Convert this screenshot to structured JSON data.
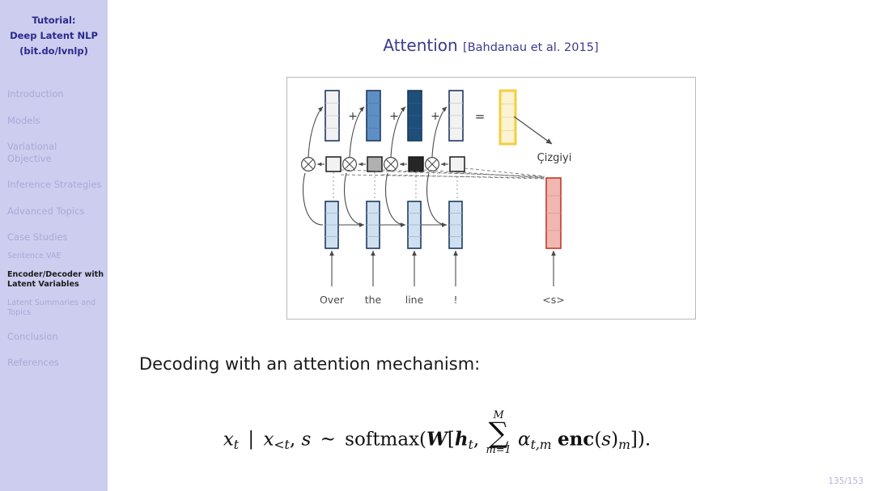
{
  "sidebar": {
    "title_lines": [
      "Tutorial:",
      "Deep Latent NLP",
      "(bit.do/lvnlp)"
    ],
    "sections": [
      {
        "label": "Introduction",
        "active": false
      },
      {
        "label": "Models",
        "active": false
      },
      {
        "label": "Variational Objective",
        "active": false
      },
      {
        "label": "Inference Strategies",
        "active": false
      },
      {
        "label": "Advanced Topics",
        "active": false
      },
      {
        "label": "Case Studies",
        "active": false
      }
    ],
    "subsections": [
      {
        "label": "Sentence VAE",
        "active": false
      },
      {
        "label": "Encoder/Decoder with Latent Variables",
        "active": true
      },
      {
        "label": "Latent Summaries and Topics",
        "active": false
      }
    ],
    "sections_tail": [
      {
        "label": "Conclusion",
        "active": false
      },
      {
        "label": "References",
        "active": false
      }
    ],
    "accent_color": "#2a2a8c",
    "background_color": "#cdcdf0",
    "inactive_color": "#a9a9d6"
  },
  "slide": {
    "title": "Attention",
    "citation": "[Bahdanau et al. 2015]",
    "title_color": "#3b3b8f",
    "body_text": "Decoding with an attention mechanism:",
    "page_number": "135/153"
  },
  "figure": {
    "input_tokens": [
      "Over",
      "the",
      "line",
      "!"
    ],
    "decoder_input_token": "<s>",
    "output_word": "Çizgiyi",
    "operators": {
      "plus": "+",
      "equals": "=",
      "times": "⊗"
    },
    "encoder_state_fill": "#cfe0f0",
    "encoder_state_border": "#1f3a5f",
    "decoder_state_fill": "#f0b8b0",
    "decoder_state_border": "#c0392b",
    "context_vector_fill": "#fdf3d2",
    "context_vector_border": "#f2cf3f",
    "weighted_vectors": [
      {
        "token": "Over",
        "fill": "#f2f2f2",
        "weight_label": "low"
      },
      {
        "token": "the",
        "fill": "#5e8fc4",
        "weight_label": "medium"
      },
      {
        "token": "line",
        "fill": "#1f4e79",
        "weight_label": "high"
      },
      {
        "token": "!",
        "fill": "#f2f2f2",
        "weight_label": "low"
      }
    ],
    "attention_weights": [
      {
        "token": "Over",
        "fill": "#f2f2f2"
      },
      {
        "token": "the",
        "fill": "#b0b0b0"
      },
      {
        "token": "line",
        "fill": "#262626"
      },
      {
        "token": "!",
        "fill": "#f2f2f2"
      }
    ],
    "frame_border_color": "#b9b9b9"
  },
  "formula": {
    "latex": "x_t \\mid x_{<t}, s \\sim \\mathrm{softmax}(\\boldsymbol{W}[\\boldsymbol{h}_t, \\sum_{m=1}^{M} \\alpha_{t,m}\\,\\mathbf{enc}(s)_m]).",
    "parts": {
      "x": "x",
      "t": "t",
      "mid": "|",
      "lt": "<t",
      "comma": ",",
      "s": "s",
      "sim": "∼",
      "softmax": "softmax(",
      "W": "W",
      "bracket_open": "[",
      "h": "h",
      "sigma": "∑",
      "sum_upper": "M",
      "sum_lower": "m=1",
      "alpha": "α",
      "alpha_sub": "t,m",
      "enc": "enc",
      "enc_arg": "(s)",
      "m": "m",
      "close": "]).",
      "M": "M"
    }
  }
}
